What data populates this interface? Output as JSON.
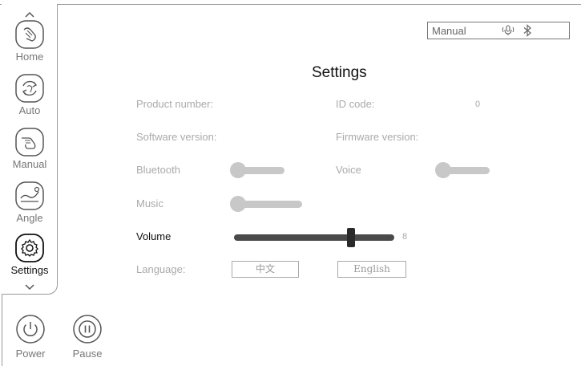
{
  "sidebar": {
    "scroll_up_icon": "chevron-up-icon",
    "scroll_down_icon": "chevron-down-icon",
    "items": [
      {
        "label": "Home",
        "icon": "hand-swipe-icon"
      },
      {
        "label": "Auto",
        "icon": "refresh-cycle-icon"
      },
      {
        "label": "Manual",
        "icon": "hand-point-icon"
      },
      {
        "label": "Angle",
        "icon": "recline-angle-icon"
      },
      {
        "label": "Settings",
        "icon": "gear-icon",
        "active": true
      }
    ]
  },
  "controls": {
    "power_label": "Power",
    "pause_label": "Pause"
  },
  "status": {
    "mode": "Manual",
    "icons": [
      "microphone-icon",
      "bluetooth-icon"
    ]
  },
  "page": {
    "title": "Settings"
  },
  "settings": {
    "product_number_label": "Product number:",
    "id_code_label": "ID code:",
    "id_code_value": "0",
    "software_version_label": "Software version:",
    "firmware_version_label": "Firmware version:",
    "bluetooth_label": "Bluetooth",
    "bluetooth_on": false,
    "voice_label": "Voice",
    "voice_on": false,
    "music_label": "Music",
    "music_on": false,
    "volume_label": "Volume",
    "volume_value": "8",
    "volume_fraction": 0.74,
    "language_label": "Language:",
    "language_options": [
      "中文",
      "English"
    ]
  },
  "colors": {
    "border": "#9a9a9a",
    "disabled_text": "#aaaaaa",
    "slider_track": "#4a4a4a",
    "toggle_off": "#c8c8c8"
  }
}
